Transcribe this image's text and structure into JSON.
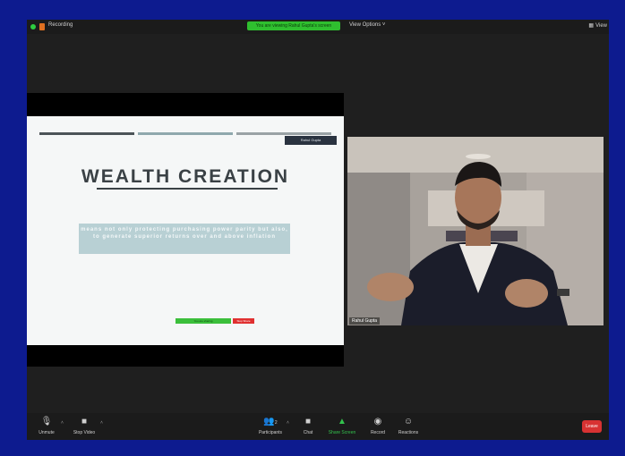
{
  "window": {
    "recording_label": "Recording",
    "share_banner": "You are viewing Rahul Gupta's screen",
    "view_options": "View Options ˅",
    "view_button": "View"
  },
  "slide": {
    "name_chip": "Rahul Gupta",
    "title": "WEALTH CREATION",
    "body": "means not only protecting purchasing power parity but also, to generate superior returns over and above inflation",
    "mini_share": "You are sharing",
    "mini_stop": "Stop Share"
  },
  "video": {
    "participant_name": "Rahul Gupta"
  },
  "toolbar": {
    "unmute": "Unmute",
    "stop_video": "Stop Video",
    "participants": "Participants",
    "participant_count": "2",
    "chat": "Chat",
    "share_screen": "Share Screen",
    "record": "Record",
    "reactions": "Reactions",
    "leave": "Leave"
  },
  "colors": {
    "frame_border": "#0d1b8f",
    "share_green": "#33c24d",
    "leave_red": "#d83232"
  }
}
